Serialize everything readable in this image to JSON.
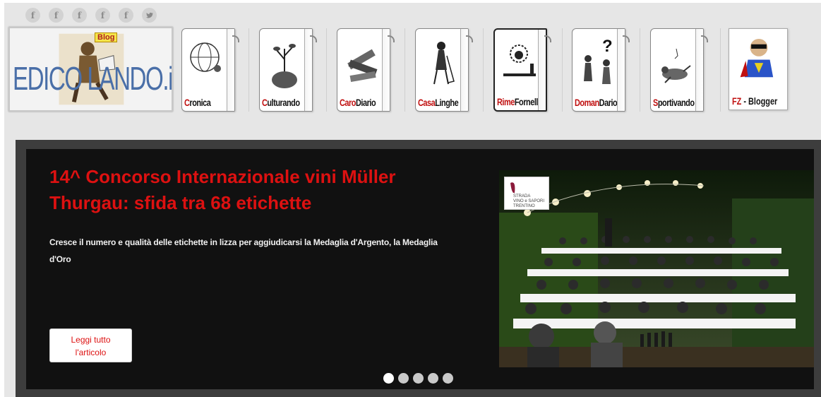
{
  "social": [
    {
      "icon": "facebook-icon",
      "glyph": "f"
    },
    {
      "icon": "facebook-icon",
      "glyph": "f"
    },
    {
      "icon": "facebook-icon",
      "glyph": "f"
    },
    {
      "icon": "facebook-icon",
      "glyph": "f"
    },
    {
      "icon": "facebook-icon",
      "glyph": "f"
    },
    {
      "icon": "twitter-icon",
      "glyph": ""
    }
  ],
  "logo": {
    "text": "EDICO   LANDO.it",
    "badge": "Blog"
  },
  "categories": [
    {
      "prefix": "C",
      "rest": "ronica",
      "icon": "globe-icon"
    },
    {
      "prefix": "C",
      "rest": "ulturando",
      "icon": "brain-tree-icon"
    },
    {
      "prefix": "Caro",
      "rest": "Diario",
      "icon": "books-icon"
    },
    {
      "prefix": "Casa",
      "rest": "Linghe",
      "icon": "housewife-icon"
    },
    {
      "prefix": "Rime",
      "rest": "Fornelli",
      "icon": "chef-icon"
    },
    {
      "prefix": "Doman",
      "rest": "Dario",
      "icon": "question-icon"
    },
    {
      "prefix": "S",
      "rest": "portivando",
      "icon": "runner-icon"
    }
  ],
  "fz": {
    "prefix": "FZ",
    "rest": " - Blogger"
  },
  "slide": {
    "title": "14^ Concorso Internazionale vini Müller Thurgau: sfida tra 68 etichette",
    "description": "Cresce il numero e qualità delle etichette in lizza per aggiudicarsi la Medaglia d'Argento, la Medaglia d'Oro",
    "button_line1": "Leggi tutto",
    "button_line2": "l'articolo",
    "badge_text": "STRADA\nVINO e SAPORI\nTRENTINO"
  },
  "slider": {
    "count": 5,
    "active": 0
  },
  "colors": {
    "accent": "#dd1111",
    "slider_bg": "#111111",
    "frame": "#3d3d3d",
    "page_bg": "#e6e6e6"
  }
}
